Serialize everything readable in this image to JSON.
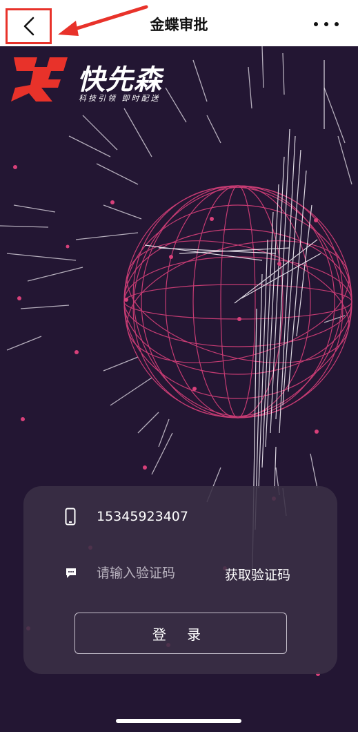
{
  "header": {
    "title": "金蝶审批",
    "back_icon": "chevron-left-icon",
    "more_icon": "more-horizontal-icon",
    "annotation_color": "#e8322a"
  },
  "brand": {
    "name": "快先森",
    "slogan": "科技引领 即时配送",
    "mark_color": "#e8322a"
  },
  "login": {
    "phone_icon": "phone-icon",
    "phone_value": "15345923407",
    "code_icon": "message-icon",
    "code_placeholder": "请输入验证码",
    "get_code_label": "获取验证码",
    "login_label": "登 录"
  },
  "theme": {
    "background": "#231633",
    "globe_color": "#d8407a",
    "card_background": "#3a3046"
  }
}
